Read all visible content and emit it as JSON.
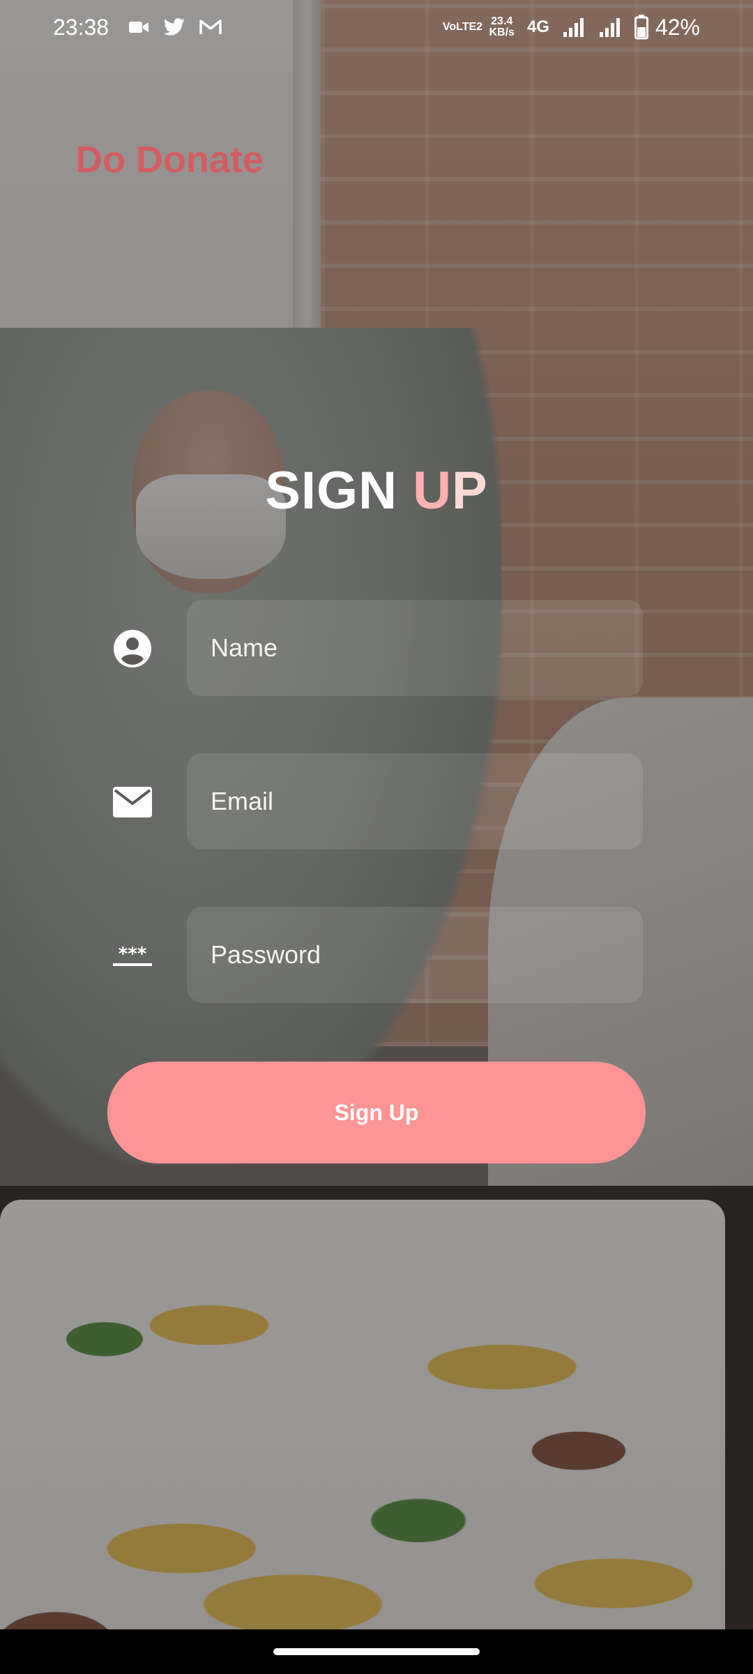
{
  "status_bar": {
    "time": "23:38",
    "network_line1": "VoLTE2",
    "speed_value": "23.4",
    "speed_unit": "KB/s",
    "network_type": "4G",
    "battery": "42%"
  },
  "app": {
    "brand": "Do Donate"
  },
  "signup": {
    "title_part1": "SIGN",
    "title_part2": " U",
    "title_part3": "P",
    "name_placeholder": "Name",
    "email_placeholder": "Email",
    "password_placeholder": "Password",
    "button_label": "Sign Up"
  },
  "colors": {
    "accent": "#ff9495",
    "brand_text": "#d9595c",
    "title_highlight": "#ffb1b0"
  },
  "icons": {
    "name": "account-circle-icon",
    "email": "mail-icon",
    "password": "password-dots-icon"
  }
}
